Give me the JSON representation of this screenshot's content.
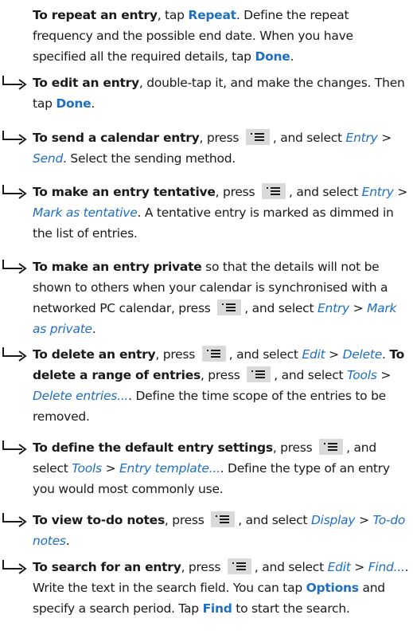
{
  "colors": {
    "accent": "#1f6fc0",
    "text": "#1a1a1a",
    "key_bg": "#d9d9d9"
  },
  "icons": {
    "bullet": "hook-arrow-icon",
    "menu_key": "menu-key-icon"
  },
  "items": [
    {
      "id": "repeat",
      "bold": "To repeat an entry",
      "t1": ", tap ",
      "key1": "Repeat",
      "t2": ". Define the repeat frequency and the possible end date. When you have specified all the required details, tap ",
      "key2": "Done",
      "t3": "."
    },
    {
      "id": "edit",
      "bold": "To edit an entry",
      "t1": ", double-tap it, and make the changes. Then tap ",
      "key1": "Done",
      "t2": "."
    },
    {
      "id": "send",
      "bold": "To send a calendar entry",
      "t1": ", press ",
      "t2": ", and select ",
      "link1": "Entry",
      "sep": " > ",
      "link2": "Send",
      "t3": ". Select the sending method."
    },
    {
      "id": "tentative",
      "bold": "To make an entry tentative",
      "t1": ", press ",
      "t2": ", and select ",
      "link1": "Entry",
      "sep": " > ",
      "link2": "Mark as tentative",
      "t3": ". A tentative entry is marked as dimmed in the list of entries."
    },
    {
      "id": "private",
      "bold": "To make an entry private",
      "t1": " so that the details will not be shown to others when your calendar is synchronised with a networked PC calendar, press ",
      "t2": ", and select ",
      "link1": "Entry",
      "sep": " > ",
      "link2": "Mark as private",
      "t3": "."
    },
    {
      "id": "delete",
      "bold": "To delete an entry",
      "t1": ", press ",
      "t2": ", and select ",
      "link1": "Edit",
      "sep": " > ",
      "link2": "Delete",
      "t3": ". ",
      "bold2": "To delete a range of entries",
      "t4": ", press ",
      "t5": ", and select ",
      "link3": "Tools",
      "sep2": " > ",
      "link4": "Delete entries...",
      "t6": ". Define the time scope of the entries to be removed."
    },
    {
      "id": "default",
      "bold": "To define the default entry settings",
      "t1": ", press ",
      "t2": ", and select ",
      "link1": "Tools",
      "sep": " > ",
      "link2": "Entry template...",
      "t3": ". Define the type of an entry you would most commonly use."
    },
    {
      "id": "todo",
      "bold": "To view to-do notes",
      "t1": ", press ",
      "t2": ", and select ",
      "link1": "Display",
      "sep": " > ",
      "link2": "To-do notes",
      "t3": "."
    },
    {
      "id": "search",
      "bold": "To search for an entry",
      "t1": ", press ",
      "t2": ", and select ",
      "link1": "Edit",
      "sep": " > ",
      "link2": "Find...",
      "t3": ". Write the text in the search field. You can tap ",
      "key1": "Options",
      "t4": " and specify a search period. Tap ",
      "key2": "Find",
      "t5": " to start the search."
    }
  ]
}
